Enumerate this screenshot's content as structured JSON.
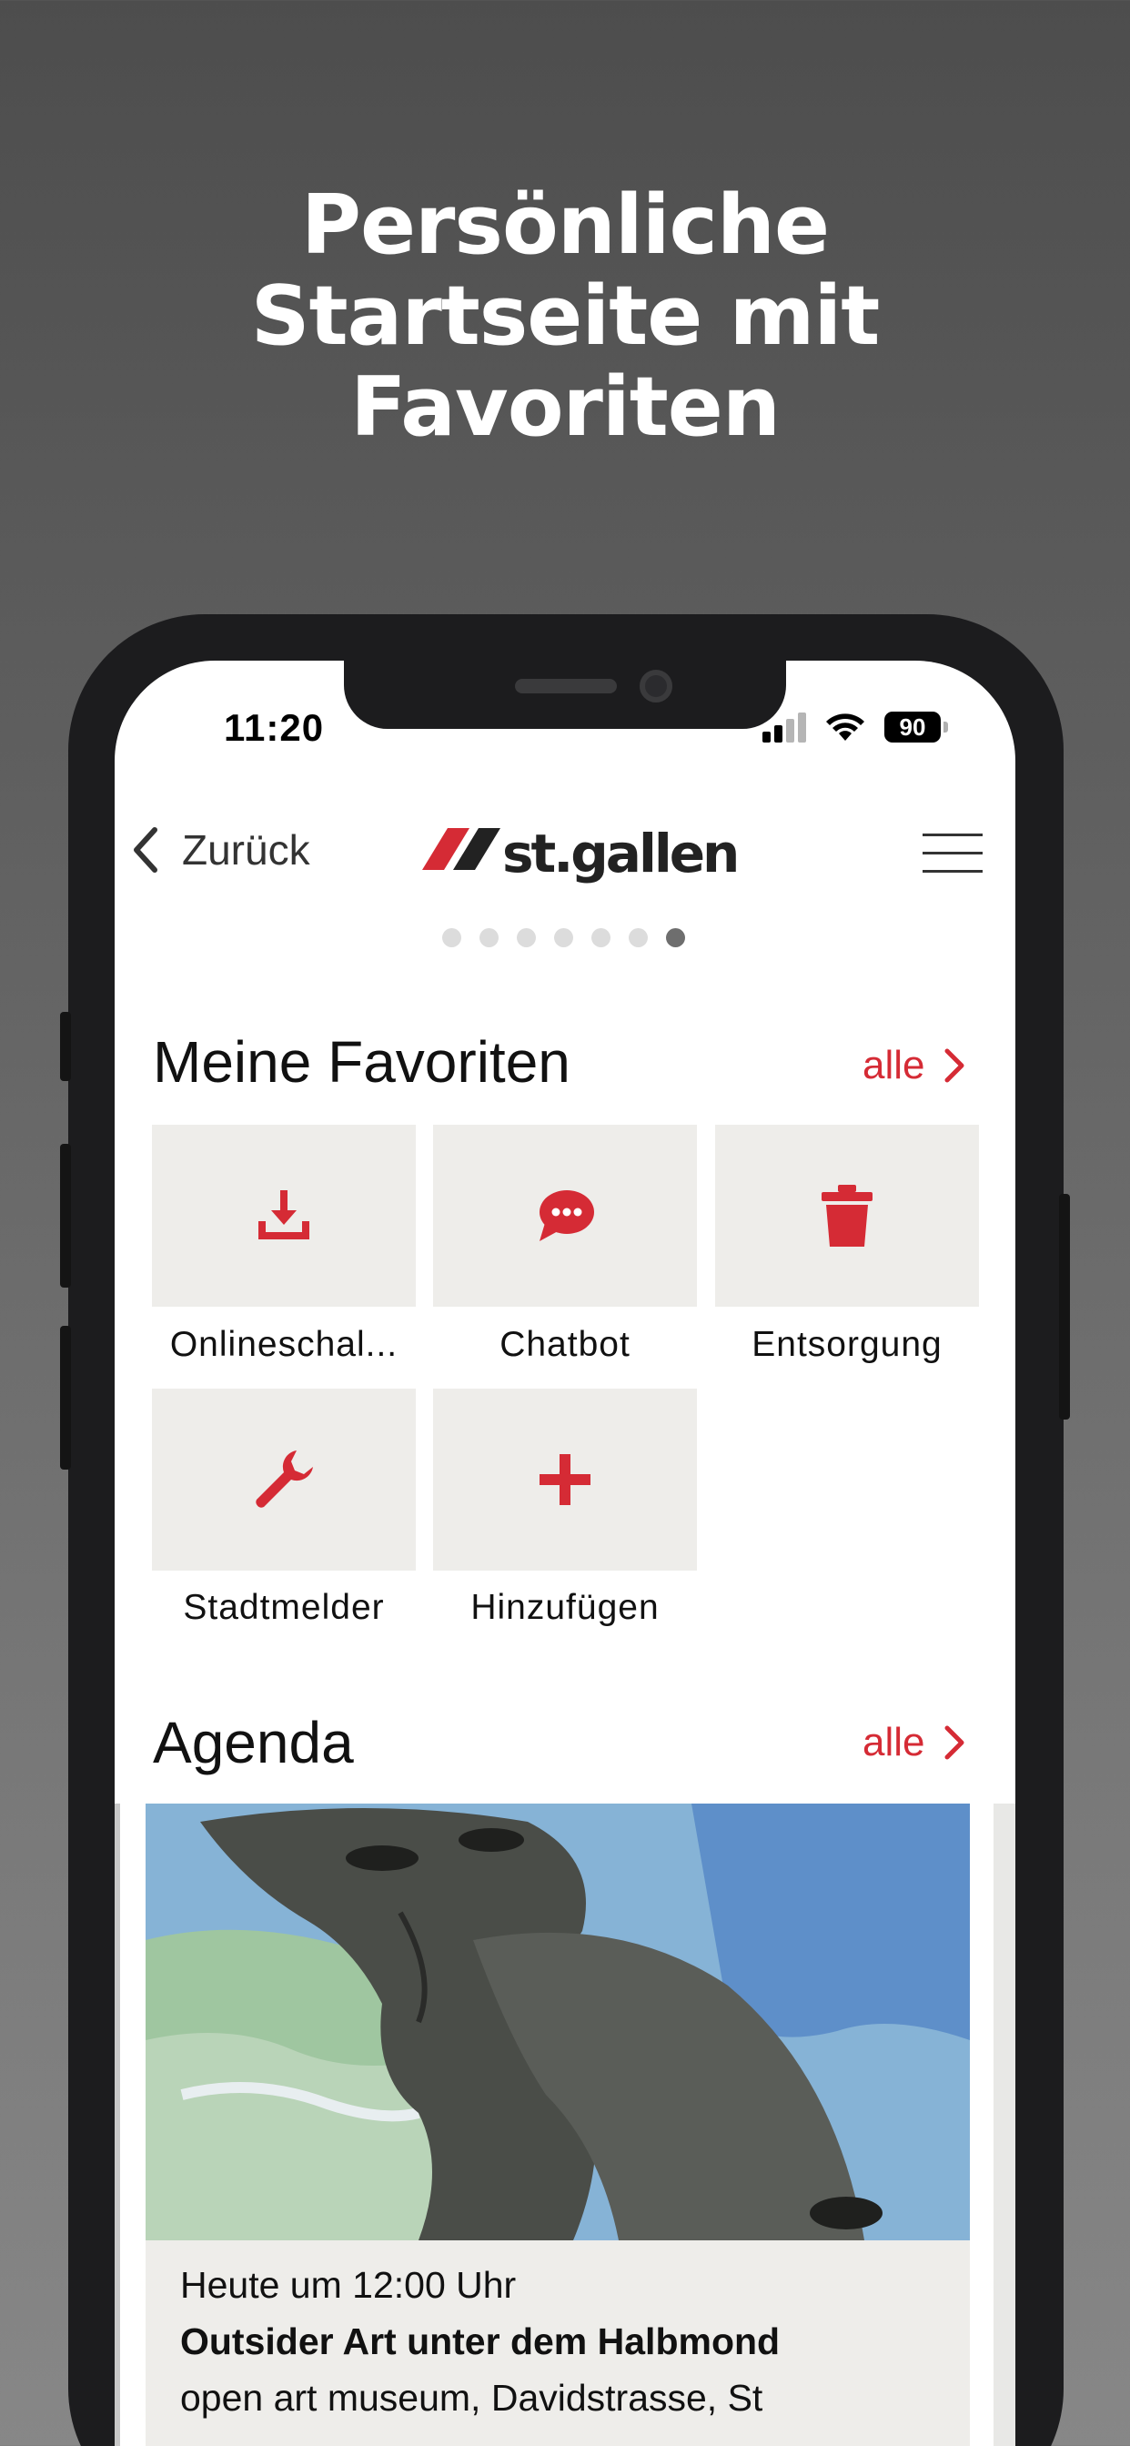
{
  "headline": [
    "Persönliche",
    "Startseite mit",
    "Favoriten"
  ],
  "status_bar": {
    "time": "11:20",
    "battery": "90"
  },
  "nav": {
    "back_label": "Zurück",
    "logo_text": "st.gallen",
    "page_dots": 7,
    "active_dot": 7
  },
  "favorites": {
    "title": "Meine Favoriten",
    "all_label": "alle",
    "items": [
      {
        "label": "Onlineschal...",
        "icon": "download-tray-icon"
      },
      {
        "label": "Chatbot",
        "icon": "chat-bubble-icon"
      },
      {
        "label": "Entsorgung",
        "icon": "trash-icon"
      },
      {
        "label": "Stadtmelder",
        "icon": "wrench-icon"
      },
      {
        "label": "Hinzufügen",
        "icon": "plus-icon"
      }
    ]
  },
  "agenda": {
    "title": "Agenda",
    "all_label": "alle",
    "event": {
      "time": "Heute um 12:00 Uhr",
      "title": "Outsider Art unter dem Halbmond",
      "place": "open art museum, Davidstrasse, St"
    }
  },
  "colors": {
    "accent": "#d52b35",
    "tile_bg": "#eeedea"
  }
}
